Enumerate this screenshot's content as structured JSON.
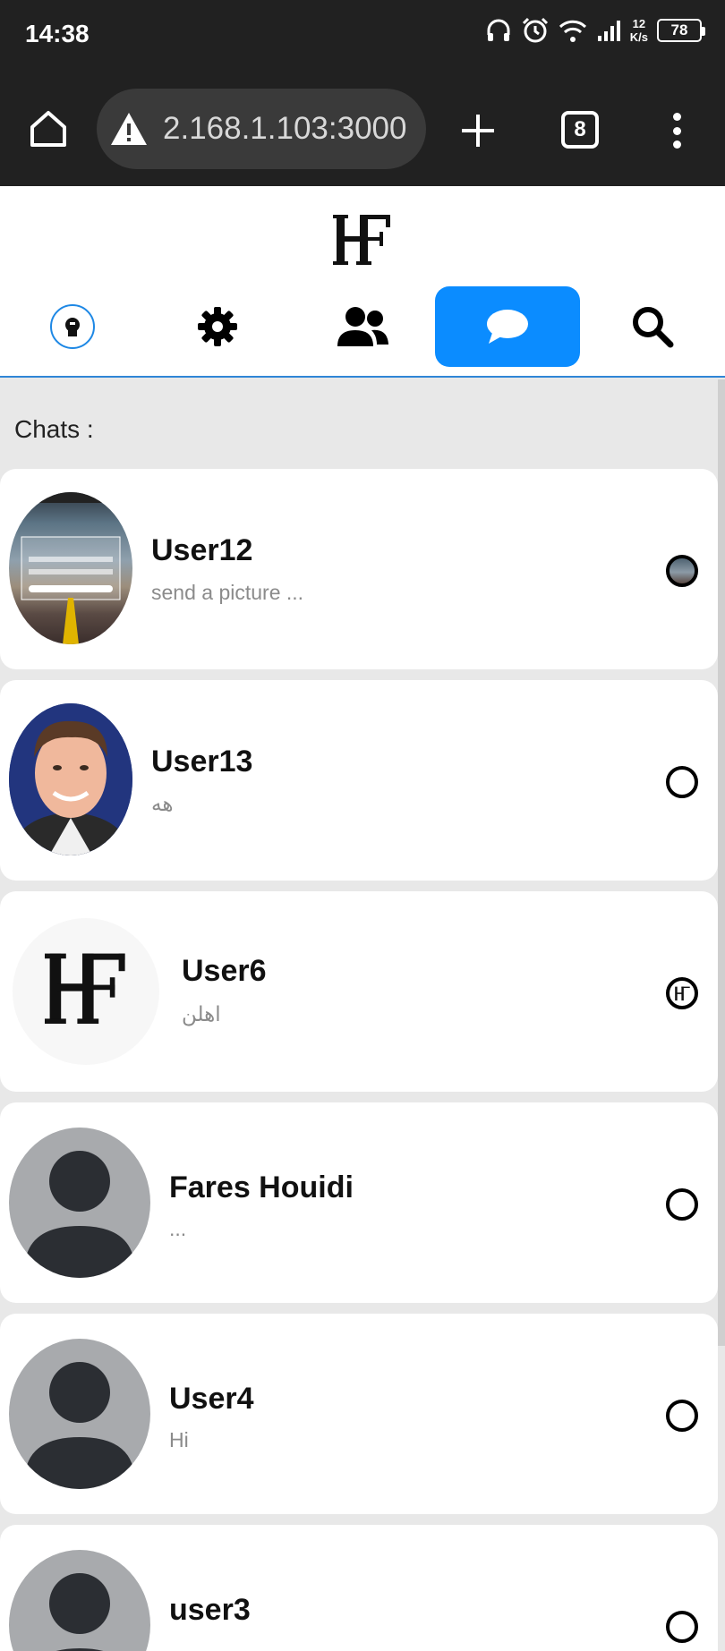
{
  "status_bar": {
    "time": "14:38",
    "net_speed_value": "12",
    "net_speed_unit": "K/s",
    "battery": "78"
  },
  "browser": {
    "url": "2.168.1.103:3000",
    "tab_count": "8",
    "icons": [
      "home-icon",
      "warning-icon",
      "plus-icon",
      "tabs-icon",
      "more-vert-icon"
    ]
  },
  "app": {
    "logo_text": "HF",
    "nav": [
      {
        "name": "profile",
        "icon": "avatar-icon"
      },
      {
        "name": "settings",
        "icon": "gear-icon"
      },
      {
        "name": "friends",
        "icon": "users-icon"
      },
      {
        "name": "chats",
        "icon": "chat-bubble-icon",
        "active": true
      },
      {
        "name": "search",
        "icon": "search-icon"
      }
    ],
    "accent_color": "#0b8cff"
  },
  "chats": {
    "label": "Chats :",
    "items": [
      {
        "name": "User12",
        "message": "send a picture ...",
        "avatar": "login-screenshot-photo"
      },
      {
        "name": "User13",
        "message": "هه",
        "avatar": "portrait-photo"
      },
      {
        "name": "User6",
        "message": "اهلن",
        "avatar": "hf-logo"
      },
      {
        "name": "Fares Houidi",
        "message": "...",
        "avatar": "default-avatar"
      },
      {
        "name": "User4",
        "message": "Hi",
        "avatar": "default-avatar"
      },
      {
        "name": "user3",
        "message": "",
        "avatar": "default-avatar"
      }
    ]
  }
}
